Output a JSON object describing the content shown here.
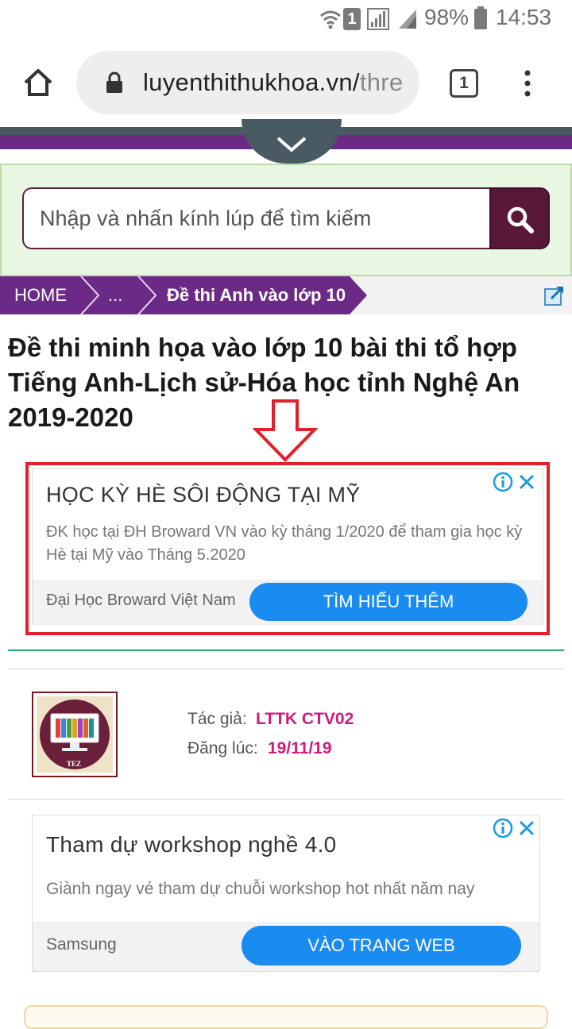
{
  "status_bar": {
    "sim_number": "1",
    "battery_percent": "98%",
    "time": "14:53"
  },
  "browser": {
    "url_main": "luyenthithukhoa.vn/",
    "url_rest": "thre",
    "tab_count": "1"
  },
  "search": {
    "placeholder": "Nhập và nhấn kính lúp để tìm kiếm"
  },
  "breadcrumb": {
    "home": "HOME",
    "ellipsis": "...",
    "current": "Đề thi Anh vào lớp 10"
  },
  "article": {
    "title": "Đề thi minh họa vào lớp 10 bài thi tổ hợp Tiếng Anh-Lịch sử-Hóa học tỉnh Nghệ An 2019-2020",
    "author_label": "Tác giả:",
    "author": "LTTK CTV02",
    "posted_label": "Đăng lúc:",
    "posted_date": "19/11/19",
    "avatar_text": "TEZ"
  },
  "ad1": {
    "title": "HỌC KỲ HÈ SÔI ĐỘNG TẠI MỸ",
    "description": "ĐK học tại ĐH Broward VN vào kỳ tháng 1/2020 để tham gia học kỳ Hè tại Mỹ vào Tháng 5.2020",
    "advertiser": "Đại Học Broward Việt Nam",
    "cta": "TÌM HIỂU THÊM"
  },
  "ad2": {
    "title": "Tham dự workshop nghề 4.0",
    "description": "Giành ngay vé tham dự chuỗi workshop hot nhất năm nay",
    "advertiser": "Samsung",
    "cta": "VÀO TRANG WEB"
  },
  "colors": {
    "purple": "#6a2a86",
    "ad_button": "#1a8bf0",
    "highlight_red": "#e0202a",
    "meta_pink": "#d01a7a"
  }
}
